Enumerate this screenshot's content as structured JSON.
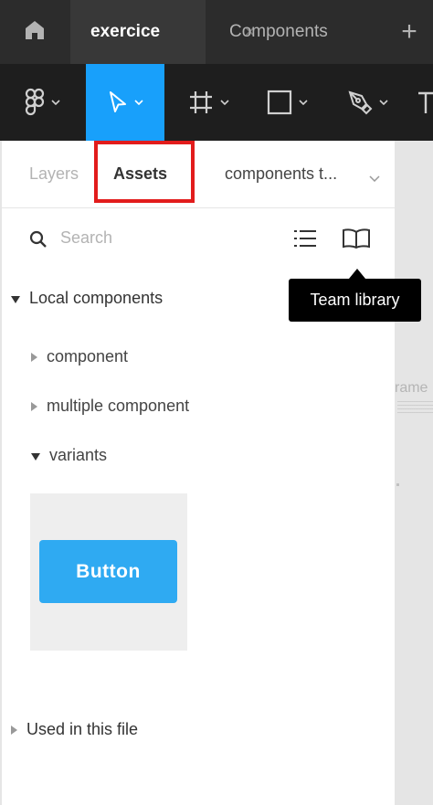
{
  "tabbar": {
    "active_tab": "exercice",
    "active_close": "×",
    "other_tab": "Components",
    "plus": "+"
  },
  "toolbar": {
    "tools": [
      "figma-menu",
      "move-tool",
      "frame-tool",
      "rectangle-tool",
      "pen-tool",
      "text-tool"
    ],
    "selected_tool": "move-tool",
    "selected_color": "#18a0fb"
  },
  "panel": {
    "tabs": {
      "layers": "Layers",
      "assets": "Assets",
      "pages": "components t..."
    },
    "highlight_color": "#e21c1c",
    "search_placeholder": "Search",
    "local_components": "Local components",
    "items": [
      {
        "label": "component",
        "expanded": false
      },
      {
        "label": "multiple component",
        "expanded": false
      },
      {
        "label": "variants",
        "expanded": true
      }
    ],
    "variant_button_label": "Button",
    "variant_button_color": "#2faaf2",
    "used_in_file": "Used in this file"
  },
  "tooltip": {
    "text": "Team library"
  },
  "canvas": {
    "frame_label": "rame"
  }
}
